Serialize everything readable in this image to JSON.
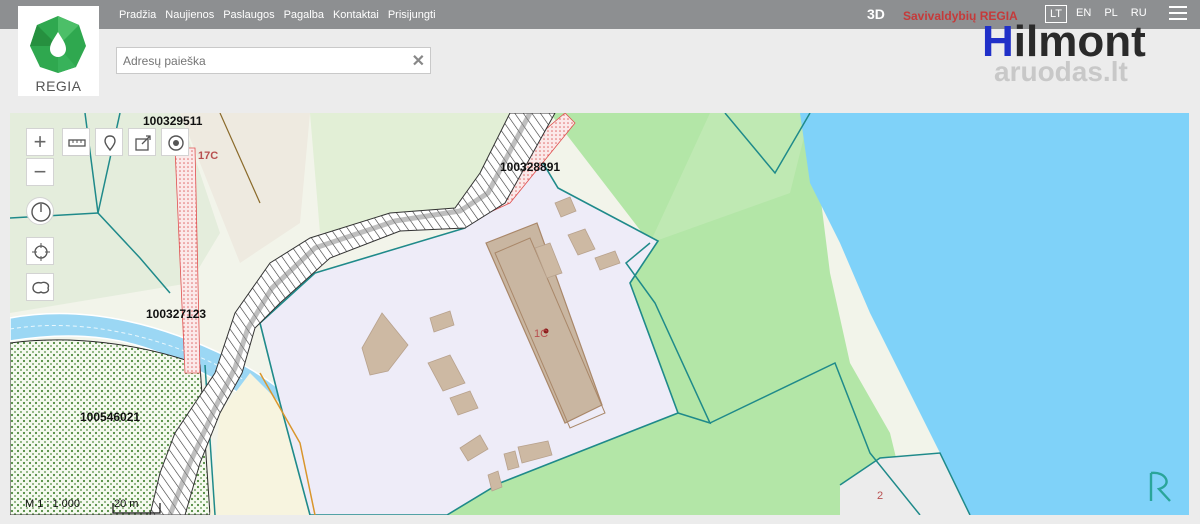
{
  "nav": [
    "Pradžia",
    "Naujienos",
    "Paslaugos",
    "Pagalba",
    "Kontaktai",
    "Prisijungti"
  ],
  "logo": {
    "name": "REGIA"
  },
  "header": {
    "mode3d": "3D",
    "title": "Savivaldybių REGIA"
  },
  "languages": [
    {
      "code": "LT",
      "active": true
    },
    {
      "code": "EN",
      "active": false
    },
    {
      "code": "PL",
      "active": false
    },
    {
      "code": "RU",
      "active": false
    }
  ],
  "search": {
    "placeholder": "Adresų paieška"
  },
  "brand": {
    "main_a": "H",
    "main_b": "ilmont",
    "sub": "aruodas.lt"
  },
  "map": {
    "parcel_labels": [
      "100329511",
      "100328891",
      "100327123",
      "100546021"
    ],
    "building_label": "1C",
    "road_label": "17C",
    "plot_number": "2",
    "scale": "M 1 : 1 000",
    "scalebar": "20 m"
  },
  "colors": {
    "water": "#7fd2f9",
    "green": "#b3e6a7",
    "parcel": "#eeecf8",
    "building": "#cdb9a3",
    "boundary": "#1f8a8a"
  },
  "icons": [
    "measure-icon",
    "pin-icon",
    "share-icon",
    "locate-icon",
    "compass-icon",
    "crosshair-icon",
    "layers-icon",
    "regia-r-icon"
  ]
}
